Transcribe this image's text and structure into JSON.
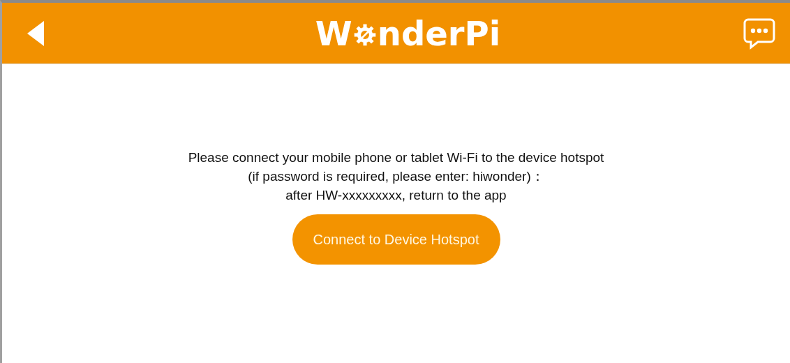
{
  "header": {
    "logo": {
      "before_gear": "W",
      "after_gear": "nderPi"
    }
  },
  "message": [
    "Please connect your mobile phone or tablet Wi-Fi to the device hotspot",
    "(if password is required, please enter: hiwonder)：",
    "after HW-xxxxxxxxx, return to the app"
  ],
  "button": {
    "label": "Connect to Device Hotspot"
  }
}
